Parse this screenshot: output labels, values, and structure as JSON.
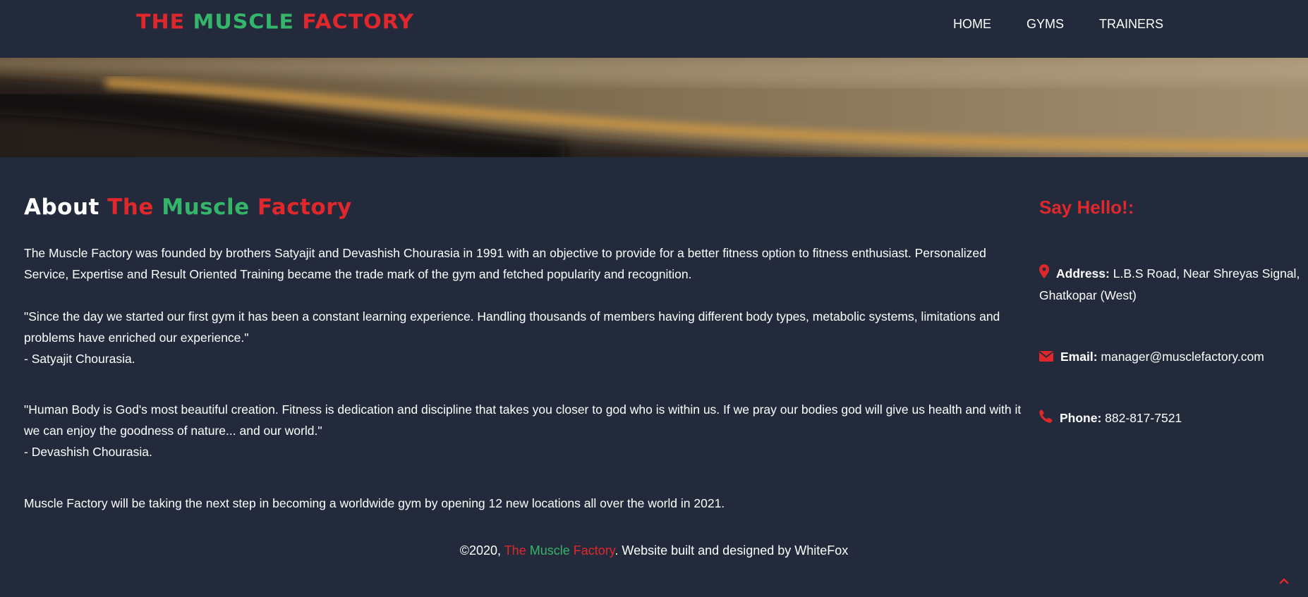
{
  "brand": {
    "part1": "THE ",
    "part2": "MUSCLE ",
    "part3": "FACTORY"
  },
  "nav": {
    "items": [
      {
        "label": "HOME"
      },
      {
        "label": "GYMS"
      },
      {
        "label": "TRAINERS"
      }
    ]
  },
  "about": {
    "title_prefix": "About ",
    "title_part1": "The ",
    "title_part2": "Muscle ",
    "title_part3": "Factory",
    "paragraph1": "The Muscle Factory was founded by brothers Satyajit and Devashish Chourasia in 1991 with an objective to provide for a better fitness option to fitness enthusiast. Personalized Service, Expertise and Result Oriented Training became the trade mark of the gym and fetched popularity and recognition.",
    "quote1": "\"Since the day we started our first gym it has been a constant learning experience. Handling thousands of members having different body types, metabolic systems, limitations and problems have enriched our experience.\"",
    "quote1_author": "- Satyajit Chourasia.",
    "quote2": "\"Human Body is God's most beautiful creation. Fitness is dedication and discipline that takes you closer to god who is within us. If we pray our bodies god will give us health and with it we can enjoy the goodness of nature... and our world.\"",
    "quote2_author": "- Devashish Chourasia.",
    "paragraph4": "Muscle Factory will be taking the next step in becoming a worldwide gym by opening 12 new locations all over the world in 2021."
  },
  "contact": {
    "title": "Say Hello!:",
    "address_label": "Address:",
    "address_value": " L.B.S Road, Near Shreyas Signal, Ghatkopar (West)",
    "email_label": "Email:",
    "email_value": " manager@musclefactory.com",
    "phone_label": "Phone:",
    "phone_value": " 882-817-7521",
    "icons": [
      "map-marker-icon",
      "envelope-icon",
      "phone-icon"
    ]
  },
  "footer": {
    "prefix": "©2020, ",
    "brand_part1": "The ",
    "brand_part2": "Muscle ",
    "brand_part3": "Factory",
    "suffix": ". Website built and designed by WhiteFox"
  },
  "colors": {
    "background": "#222a3b",
    "brand_red": "#e0282c",
    "brand_green": "#35b56a",
    "text": "#ffffff"
  },
  "back_to_top": {
    "icon": "chevron-up-icon"
  }
}
